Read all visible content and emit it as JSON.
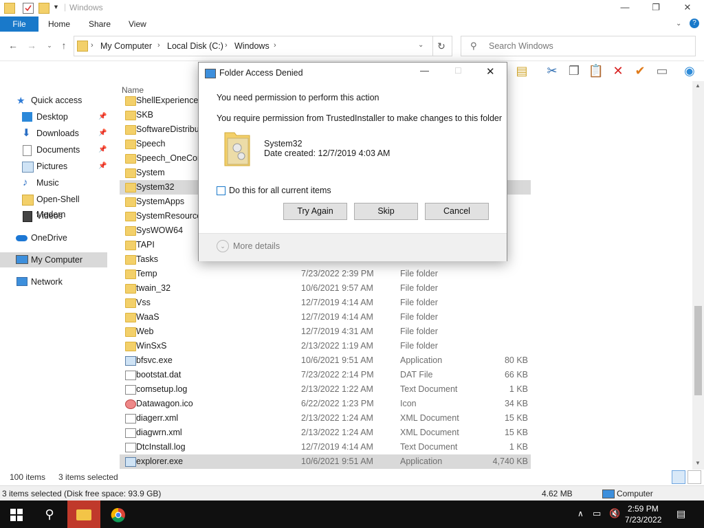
{
  "window": {
    "title": "Windows",
    "controls": {
      "minimize": "—",
      "maximize": "❐",
      "close": "✕"
    }
  },
  "ribbon": {
    "tabs": [
      "File",
      "Home",
      "Share",
      "View"
    ],
    "help_icon": "?"
  },
  "address": {
    "crumbs": [
      "My Computer",
      "Local Disk (C:)",
      "Windows"
    ],
    "search_placeholder": "Search Windows"
  },
  "nav_pane": {
    "items": [
      {
        "label": "Quick access",
        "icon": "star-icon"
      },
      {
        "label": "Desktop",
        "icon": "desktop-icon",
        "pinned": true
      },
      {
        "label": "Downloads",
        "icon": "download-icon",
        "pinned": true
      },
      {
        "label": "Documents",
        "icon": "documents-icon",
        "pinned": true
      },
      {
        "label": "Pictures",
        "icon": "pictures-icon",
        "pinned": true
      },
      {
        "label": "Music",
        "icon": "music-icon"
      },
      {
        "label": "Open-Shell Modern",
        "icon": "folder-icon"
      },
      {
        "label": "Videos",
        "icon": "videos-icon"
      },
      {
        "label": "OneDrive",
        "icon": "cloud-icon"
      },
      {
        "label": "My Computer",
        "icon": "computer-icon"
      },
      {
        "label": "Network",
        "icon": "network-icon"
      }
    ]
  },
  "file_list": {
    "column_name": "Name",
    "rows": [
      {
        "name": "ShellExperiences",
        "date": "",
        "type": "",
        "size": "",
        "kind": "folder"
      },
      {
        "name": "SKB",
        "date": "",
        "type": "",
        "size": "",
        "kind": "folder"
      },
      {
        "name": "SoftwareDistribut",
        "date": "",
        "type": "",
        "size": "",
        "kind": "folder"
      },
      {
        "name": "Speech",
        "date": "",
        "type": "",
        "size": "",
        "kind": "folder"
      },
      {
        "name": "Speech_OneCore",
        "date": "",
        "type": "",
        "size": "",
        "kind": "folder"
      },
      {
        "name": "System",
        "date": "",
        "type": "",
        "size": "",
        "kind": "folder"
      },
      {
        "name": "System32",
        "date": "",
        "type": "",
        "size": "",
        "kind": "folder",
        "selected": true
      },
      {
        "name": "SystemApps",
        "date": "",
        "type": "",
        "size": "",
        "kind": "folder"
      },
      {
        "name": "SystemResources",
        "date": "",
        "type": "",
        "size": "",
        "kind": "folder"
      },
      {
        "name": "SysWOW64",
        "date": "",
        "type": "",
        "size": "",
        "kind": "folder"
      },
      {
        "name": "TAPI",
        "date": "",
        "type": "",
        "size": "",
        "kind": "folder"
      },
      {
        "name": "Tasks",
        "date": "",
        "type": "",
        "size": "",
        "kind": "folder"
      },
      {
        "name": "Temp",
        "date": "7/23/2022 2:39 PM",
        "type": "File folder",
        "size": "",
        "kind": "folder"
      },
      {
        "name": "twain_32",
        "date": "10/6/2021 9:57 AM",
        "type": "File folder",
        "size": "",
        "kind": "folder"
      },
      {
        "name": "Vss",
        "date": "12/7/2019 4:14 AM",
        "type": "File folder",
        "size": "",
        "kind": "folder"
      },
      {
        "name": "WaaS",
        "date": "12/7/2019 4:14 AM",
        "type": "File folder",
        "size": "",
        "kind": "folder"
      },
      {
        "name": "Web",
        "date": "12/7/2019 4:31 AM",
        "type": "File folder",
        "size": "",
        "kind": "folder"
      },
      {
        "name": "WinSxS",
        "date": "2/13/2022 1:19 AM",
        "type": "File folder",
        "size": "",
        "kind": "folder"
      },
      {
        "name": "bfsvc.exe",
        "date": "10/6/2021 9:51 AM",
        "type": "Application",
        "size": "80 KB",
        "kind": "app"
      },
      {
        "name": "bootstat.dat",
        "date": "7/23/2022 2:14 PM",
        "type": "DAT File",
        "size": "66 KB",
        "kind": "file"
      },
      {
        "name": "comsetup.log",
        "date": "2/13/2022 1:22 AM",
        "type": "Text Document",
        "size": "1 KB",
        "kind": "file"
      },
      {
        "name": "Datawagon.ico",
        "date": "6/22/2022 1:23 PM",
        "type": "Icon",
        "size": "34 KB",
        "kind": "icofile"
      },
      {
        "name": "diagerr.xml",
        "date": "2/13/2022 1:24 AM",
        "type": "XML Document",
        "size": "15 KB",
        "kind": "file"
      },
      {
        "name": "diagwrn.xml",
        "date": "2/13/2022 1:24 AM",
        "type": "XML Document",
        "size": "15 KB",
        "kind": "file"
      },
      {
        "name": "DtcInstall.log",
        "date": "12/7/2019 4:14 AM",
        "type": "Text Document",
        "size": "1 KB",
        "kind": "file"
      },
      {
        "name": "explorer.exe",
        "date": "10/6/2021 9:51 AM",
        "type": "Application",
        "size": "4,740 KB",
        "kind": "app",
        "selected": true
      }
    ]
  },
  "status": {
    "item_count": "100 items",
    "selected_count": "3 items selected",
    "details_left": "3 items selected (Disk free space: 93.9 GB)",
    "details_size": "4.62 MB",
    "details_location": "Computer"
  },
  "dialog": {
    "title": "Folder Access Denied",
    "message1": "You need permission to perform this action",
    "message2": "You require permission from TrustedInstaller to make changes to this folder",
    "item_name": "System32",
    "item_date": "Date created: 12/7/2019 4:03 AM",
    "checkbox_label": "Do this for all current items",
    "buttons": {
      "try_again": "Try Again",
      "skip": "Skip",
      "cancel": "Cancel"
    },
    "more_details": "More details"
  },
  "taskbar": {
    "time": "2:59 PM",
    "date": "7/23/2022"
  }
}
